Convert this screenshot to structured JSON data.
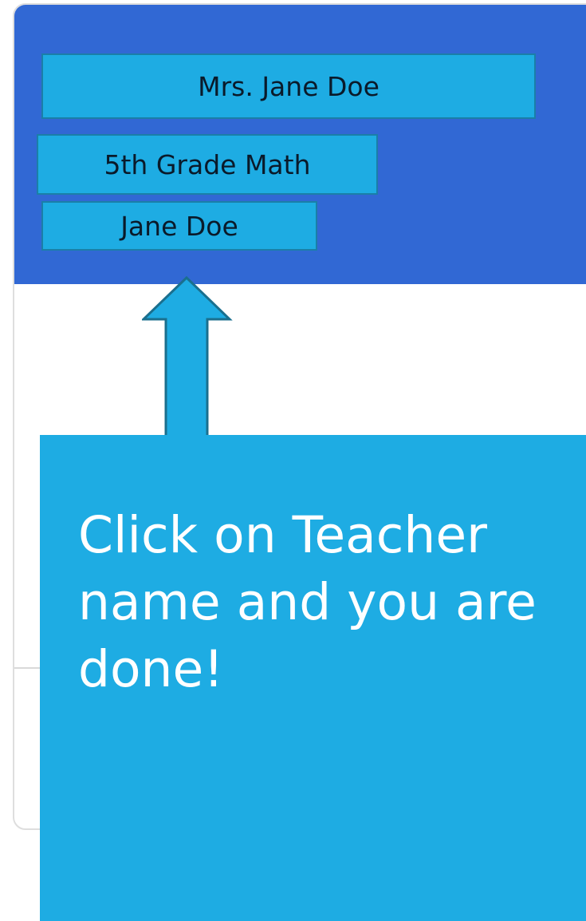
{
  "header_labels": {
    "teacher": "Mrs. Jane Doe",
    "course": "5th Grade Math",
    "student": "Jane Doe"
  },
  "callout": {
    "text": "Click on Teacher name and you are done!"
  },
  "icons": {
    "pointer": "up-arrow-icon"
  },
  "colors": {
    "header_bg": "#3168d4",
    "label_bg": "#1eace3",
    "callout_bg": "#1eace3",
    "callout_text": "#ffffff"
  }
}
